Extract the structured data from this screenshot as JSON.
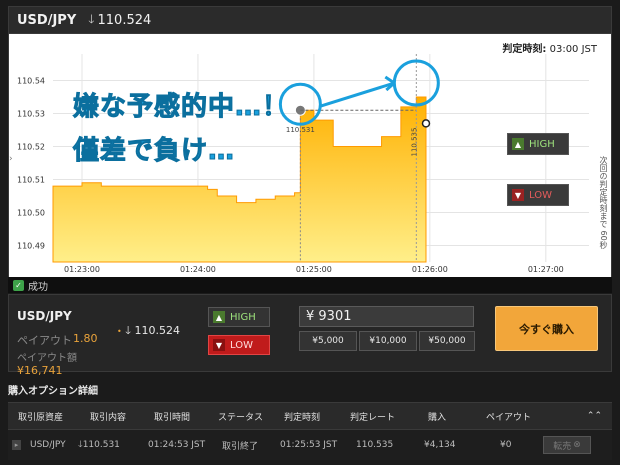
{
  "header": {
    "pair": "USD/JPY",
    "direction_icon": "down-arrow-icon",
    "rate": "110.524"
  },
  "chart_frame": {
    "judge_time_label": "判定時刻:",
    "judge_time_value": "03:00 JST",
    "side_high_label": "HIGH",
    "side_low_label": "LOW",
    "vertical_label": "次回の判定時刻まで 60秒"
  },
  "annotation": {
    "line1": "嫌な予感的中…！",
    "line2": "僅差で負け…"
  },
  "chart_data": {
    "type": "area",
    "y_ticks": [
      "110.54",
      "110.53",
      "110.52",
      "110.51",
      "110.50",
      "110.49"
    ],
    "ylim": [
      110.485,
      110.545
    ],
    "x_ticks": [
      "01:23:00",
      "01:24:00",
      "01:25:00",
      "01:26:00",
      "01:27:00"
    ],
    "entry_marker_label": "110.531",
    "judge_marker_label": "110.535",
    "series": [
      {
        "x": [
          "01:22:45",
          "01:23:00",
          "01:23:10",
          "01:23:20",
          "01:23:30",
          "01:23:40",
          "01:23:50",
          "01:24:00",
          "01:24:05",
          "01:24:10",
          "01:24:20",
          "01:24:30",
          "01:24:40",
          "01:24:50",
          "01:24:53",
          "01:25:00",
          "01:25:10",
          "01:25:20",
          "01:25:30",
          "01:25:35",
          "01:25:45",
          "01:25:53",
          "01:25:58"
        ],
        "y": [
          110.508,
          110.509,
          110.508,
          110.508,
          110.508,
          110.508,
          110.508,
          110.508,
          110.507,
          110.505,
          110.503,
          110.504,
          110.505,
          110.506,
          110.531,
          110.528,
          110.52,
          110.52,
          110.52,
          110.523,
          110.532,
          110.535,
          110.527
        ]
      }
    ],
    "grid": true
  },
  "colors": {
    "area_top": "#ffb000",
    "area_bottom": "#ffef8a",
    "annotation": "#1aa0dd",
    "accent_orange": "#f2a63a",
    "high_green": "#9ee37d",
    "low_red": "#c01b1b"
  },
  "status": {
    "icon": "check-icon",
    "label": "成功"
  },
  "panel": {
    "pair": "USD/JPY",
    "payout_label": "ペイアウト",
    "payout_value": "1.80",
    "payout_amount_label": "ペイアウト額",
    "payout_amount_value": "¥16,741",
    "rate": "110.524",
    "high_label": "HIGH",
    "low_label": "LOW",
    "amount_value": "¥ 9301",
    "chips": [
      "¥5,000",
      "¥10,000",
      "¥50,000"
    ],
    "buy_label": "今すぐ購入"
  },
  "details": {
    "title": "購入オプション詳細",
    "columns": [
      "取引原資産",
      "取引内容",
      "取引時間",
      "ステータス",
      "判定時刻",
      "判定レート",
      "購入",
      "ペイアウト"
    ],
    "rows": [
      [
        "USD/JPY",
        "110.531",
        "01:24:53 JST",
        "取引終了",
        "01:25:53 JST",
        "110.535",
        "¥4,134",
        "¥0"
      ]
    ],
    "sell_label": "転売"
  }
}
